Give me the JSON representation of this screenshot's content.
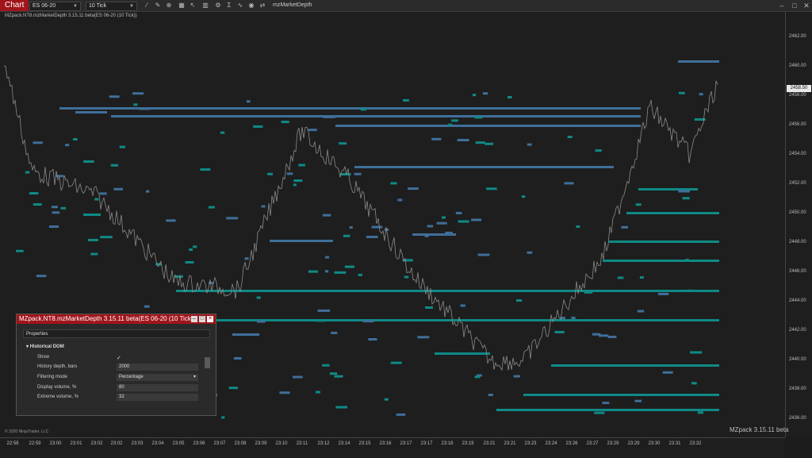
{
  "toolbar": {
    "chart_tab": "Chart",
    "instrument": "ES 06-20",
    "interval": "10 Tick",
    "indicator": "mzMarketDepth"
  },
  "chart": {
    "label": "MZpack.NT8.mzMarketDepth 3.15.11 beta(ES 06-20 (10 Tick))",
    "current_price": "2458.50",
    "price_ticks": [
      "2462.00",
      "2460.00",
      "2458.00",
      "2456.00",
      "2454.00",
      "2452.00",
      "2450.00",
      "2448.00",
      "2446.00",
      "2444.00",
      "2442.00",
      "2440.00",
      "2438.00",
      "2436.00"
    ],
    "time_ticks": [
      "22:58",
      "22:59",
      "23:00",
      "23:01",
      "23:02",
      "23:02",
      "23:03",
      "23:04",
      "23:05",
      "23:06",
      "23:07",
      "23:08",
      "23:09",
      "23:10",
      "23:11",
      "23:12",
      "23:14",
      "23:15",
      "23:16",
      "23:17",
      "23:17",
      "23:18",
      "23:19",
      "23:21",
      "23:21",
      "23:23",
      "23:24",
      "23:26",
      "23:27",
      "23:29",
      "23:29",
      "23:30",
      "23:31",
      "23:32"
    ],
    "copyright": "© 2020 NinjaTrader, LLC",
    "watermark": "MZpack 3.15.11 beta"
  },
  "panel": {
    "title": "MZpack.NT8.mzMarketDepth 3.15.11 beta(ES 06-20 (10 Tick",
    "properties_label": "Properties",
    "section": "Historical DOM",
    "rows": [
      {
        "label": "Show",
        "value": "✓"
      },
      {
        "label": "History depth, bars",
        "value": "2000"
      },
      {
        "label": "Filtering mode",
        "value": "Percentage"
      },
      {
        "label": "Display volume, %",
        "value": "80"
      },
      {
        "label": "Extreme volume, %",
        "value": "32"
      }
    ]
  },
  "colors": {
    "ask": "#3f6f9a",
    "bid": "#0f8a86",
    "accent": "#a0151b"
  }
}
